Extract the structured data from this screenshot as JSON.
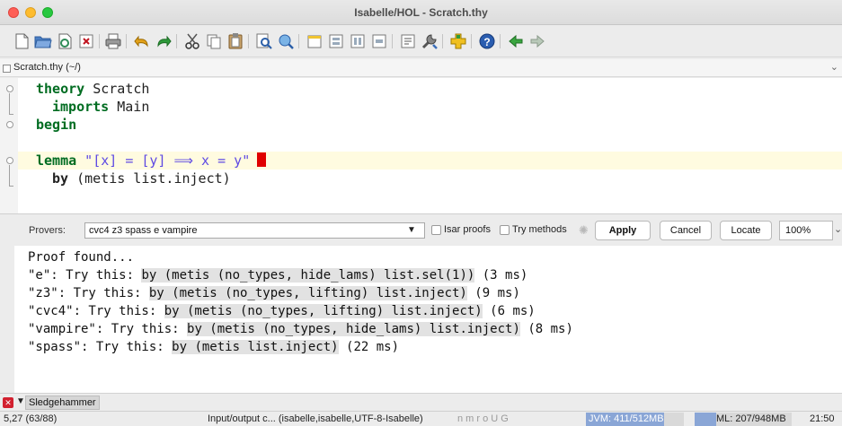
{
  "window": {
    "title": "Isabelle/HOL - Scratch.thy"
  },
  "toolbar": {
    "icons": [
      "new-file-icon",
      "open-folder-icon",
      "reload-icon",
      "close-file-icon",
      "print-icon",
      "undo-icon",
      "redo-icon",
      "cut-icon",
      "copy-icon",
      "paste-icon",
      "find-icon",
      "find-in-files-icon",
      "new-view-icon",
      "split-horizontal-icon",
      "split-vertical-icon",
      "unsplit-icon",
      "buffer-options-icon",
      "global-options-icon",
      "plugin-manager-icon",
      "help-icon",
      "back-icon",
      "forward-icon"
    ]
  },
  "file_tab": {
    "label": "Scratch.thy (~/)"
  },
  "editor": {
    "lines": [
      {
        "kw": "theory",
        "rest": " Scratch"
      },
      {
        "kw": "imports",
        "rest": " Main"
      },
      {
        "kw": "begin",
        "rest": ""
      },
      {
        "kw": "lemma",
        "rest": " \"[x] = [y] ⟹ x = y\""
      },
      {
        "kw": "by",
        "rest": " (metis list.inject)"
      }
    ]
  },
  "sledgehammer": {
    "provers_label": "Provers:",
    "provers_value": "cvc4 z3 spass e vampire",
    "isar_proofs_label": "Isar proofs",
    "try_methods_label": "Try methods",
    "apply_label": "Apply",
    "cancel_label": "Cancel",
    "locate_label": "Locate",
    "zoom_value": "100%",
    "output": [
      {
        "pre": "Proof found...",
        "cmd": "",
        "post": ""
      },
      {
        "pre": "\"e\": Try this: ",
        "cmd": "by (metis (no_types, hide_lams) list.sel(1))",
        "post": " (3 ms)"
      },
      {
        "pre": "\"z3\": Try this: ",
        "cmd": "by (metis (no_types, lifting) list.inject)",
        "post": " (9 ms)"
      },
      {
        "pre": "\"cvc4\": Try this: ",
        "cmd": "by (metis (no_types, lifting) list.inject)",
        "post": " (6 ms)"
      },
      {
        "pre": "\"vampire\": Try this: ",
        "cmd": "by (metis (no_types, hide_lams) list.inject)",
        "post": " (8 ms)"
      },
      {
        "pre": "\"spass\": Try this: ",
        "cmd": "by (metis list.inject)",
        "post": " (22 ms)"
      }
    ]
  },
  "dock": {
    "tab_label": "Sledgehammer"
  },
  "status": {
    "position": "5,27 (63/88)",
    "mode": "Input/output c... (isabelle,isabelle,UTF-8-Isabelle)",
    "flags": "n m r o U G",
    "jvm_memory": "JVM: 411/512MB",
    "jvm_fraction": 0.8,
    "ml_memory": "ML: 207/948MB",
    "ml_fraction": 0.22,
    "time": "21:50"
  }
}
